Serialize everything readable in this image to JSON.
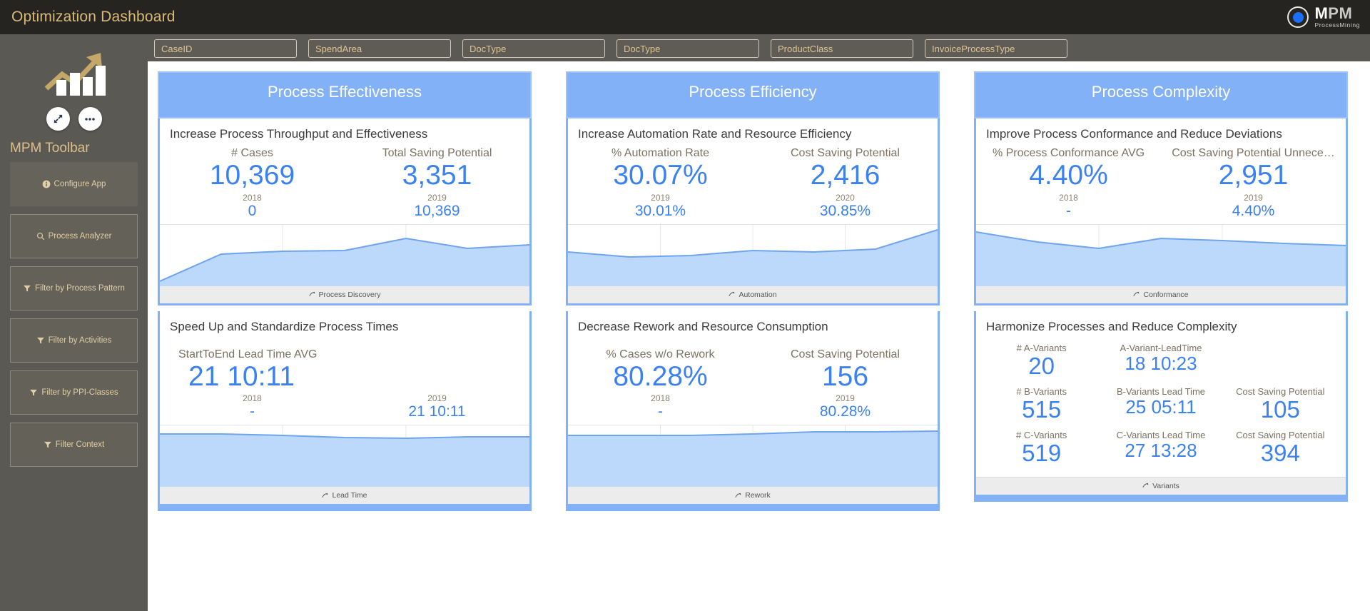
{
  "titlebar": {
    "title": "Optimization Dashboard",
    "brand_name_first": "M",
    "brand_name_rest": "PM",
    "brand_subtitle": "ProcessMining",
    "accent_gold": "#d9b978",
    "accent_blue": "#1c6ff5"
  },
  "sidebar": {
    "heading": "MPM Toolbar",
    "expand_icon": "expand-arrows-icon",
    "more_icon": "ellipsis-icon",
    "buttons": [
      {
        "label": "Configure App",
        "icon": "info-icon"
      },
      {
        "label": "Process Analyzer",
        "icon": "magnifier-icon"
      },
      {
        "label": "Filter by Process Pattern",
        "icon": "funnel-icon"
      },
      {
        "label": "Filter by Activities",
        "icon": "funnel-icon"
      },
      {
        "label": "Filter by PPI-Classes",
        "icon": "funnel-icon"
      },
      {
        "label": "Filter Context",
        "icon": "funnel-icon"
      }
    ]
  },
  "filters": [
    {
      "name": "caseid",
      "placeholder": "CaseID",
      "value": ""
    },
    {
      "name": "spendarea",
      "placeholder": "SpendArea",
      "value": ""
    },
    {
      "name": "doctype-1",
      "placeholder": "DocType",
      "value": ""
    },
    {
      "name": "doctype-2",
      "placeholder": "DocType",
      "value": ""
    },
    {
      "name": "productclass",
      "placeholder": "ProductClass",
      "value": ""
    },
    {
      "name": "invoiceprocesstype",
      "placeholder": "InvoiceProcessType",
      "value": ""
    }
  ],
  "columns": [
    {
      "header": "Process Effectiveness",
      "cards": [
        {
          "title": "Increase Process Throughput and Effectiveness",
          "kpis": [
            {
              "label": "# Cases",
              "value": "10,369"
            },
            {
              "label": "Total Saving Potential",
              "value": "3,351"
            }
          ],
          "years": [
            {
              "label": "2018",
              "value": "0"
            },
            {
              "label": "2019",
              "value": "10,369"
            }
          ],
          "footer_link": "Process Discovery",
          "footer_icon": "arrow-forward-icon"
        },
        {
          "title": "Speed Up and Standardize Process Times",
          "kpis": [
            {
              "label": "StartToEnd Lead Time AVG",
              "value": "21 10:11"
            }
          ],
          "years": [
            {
              "label": "2018",
              "value": "-"
            },
            {
              "label": "2019",
              "value": "21 10:11"
            }
          ],
          "footer_link": "Lead Time",
          "footer_icon": "arrow-forward-icon"
        }
      ]
    },
    {
      "header": "Process Efficiency",
      "cards": [
        {
          "title": "Increase Automation Rate and Resource Efficiency",
          "kpis": [
            {
              "label": "% Automation Rate",
              "value": "30.07%"
            },
            {
              "label": "Cost Saving Potential",
              "value": "2,416"
            }
          ],
          "years": [
            {
              "label": "2019",
              "value": "30.01%"
            },
            {
              "label": "2020",
              "value": "30.85%"
            }
          ],
          "footer_link": "Automation",
          "footer_icon": "arrow-forward-icon"
        },
        {
          "title": "Decrease Rework and Resource Consumption",
          "kpis": [
            {
              "label": "% Cases w/o Rework",
              "value": "80.28%"
            },
            {
              "label": "Cost Saving Potential",
              "value": "156"
            }
          ],
          "years": [
            {
              "label": "2018",
              "value": "-"
            },
            {
              "label": "2019",
              "value": "80.28%"
            }
          ],
          "footer_link": "Rework",
          "footer_icon": "arrow-forward-icon"
        }
      ]
    },
    {
      "header": "Process Complexity",
      "cards": [
        {
          "title": "Improve Process Conformance and Reduce Deviations",
          "kpis": [
            {
              "label": "% Process Conformance AVG",
              "value": "4.40%"
            },
            {
              "label": "Cost Saving Potential Unnece…",
              "value": "2,951"
            }
          ],
          "years": [
            {
              "label": "2018",
              "value": "-"
            },
            {
              "label": "2019",
              "value": "4.40%"
            }
          ],
          "footer_link": "Conformance",
          "footer_icon": "arrow-forward-icon"
        },
        {
          "title": "Harmonize Processes and Reduce Complexity",
          "variants": [
            [
              {
                "label": "# A-Variants",
                "value": "20"
              },
              {
                "label": "A-Variant-LeadTime",
                "value": "18 10:23"
              },
              {
                "label": "",
                "value": ""
              }
            ],
            [
              {
                "label": "# B-Variants",
                "value": "515"
              },
              {
                "label": "B-Variants Lead Time",
                "value": "25 05:11"
              },
              {
                "label": "Cost Saving Potential",
                "value": "105"
              }
            ],
            [
              {
                "label": "# C-Variants",
                "value": "519"
              },
              {
                "label": "C-Variants Lead Time",
                "value": "27 13:28"
              },
              {
                "label": "Cost Saving Potential",
                "value": "394"
              }
            ]
          ],
          "footer_link": "Variants",
          "footer_icon": "arrow-forward-icon"
        }
      ]
    }
  ],
  "chart_data": [
    {
      "type": "area",
      "title": "Increase Process Throughput and Effectiveness sparkline",
      "x": [
        0,
        1,
        2,
        3,
        4,
        5,
        6
      ],
      "values": [
        8,
        52,
        57,
        58,
        78,
        62,
        68
      ],
      "ylim": [
        0,
        100
      ],
      "grid": true,
      "legend": "none"
    },
    {
      "type": "area",
      "title": "Speed Up and Standardize Process Times sparkline",
      "x": [
        0,
        1,
        2,
        3,
        4,
        5,
        6
      ],
      "values": [
        86,
        86,
        84,
        80,
        79,
        82,
        82
      ],
      "ylim": [
        0,
        100
      ],
      "grid": true,
      "legend": "none"
    },
    {
      "type": "area",
      "title": "Increase Automation Rate and Resource Efficiency sparkline",
      "x": [
        0,
        1,
        2,
        3,
        4,
        5,
        6
      ],
      "values": [
        56,
        48,
        50,
        58,
        56,
        60,
        92
      ],
      "ylim": [
        0,
        100
      ],
      "grid": true,
      "legend": "none"
    },
    {
      "type": "area",
      "title": "Decrease Rework and Resource Consumption sparkline",
      "x": [
        0,
        1,
        2,
        3,
        4,
        5,
        6
      ],
      "values": [
        84,
        84,
        84,
        86,
        90,
        90,
        91
      ],
      "ylim": [
        0,
        100
      ],
      "grid": true,
      "legend": "none"
    },
    {
      "type": "area",
      "title": "Improve Process Conformance and Reduce Deviations sparkline",
      "x": [
        0,
        1,
        2,
        3,
        4,
        5,
        6
      ],
      "values": [
        88,
        72,
        62,
        78,
        74,
        70,
        66
      ],
      "ylim": [
        0,
        100
      ],
      "grid": true,
      "legend": "none"
    }
  ]
}
